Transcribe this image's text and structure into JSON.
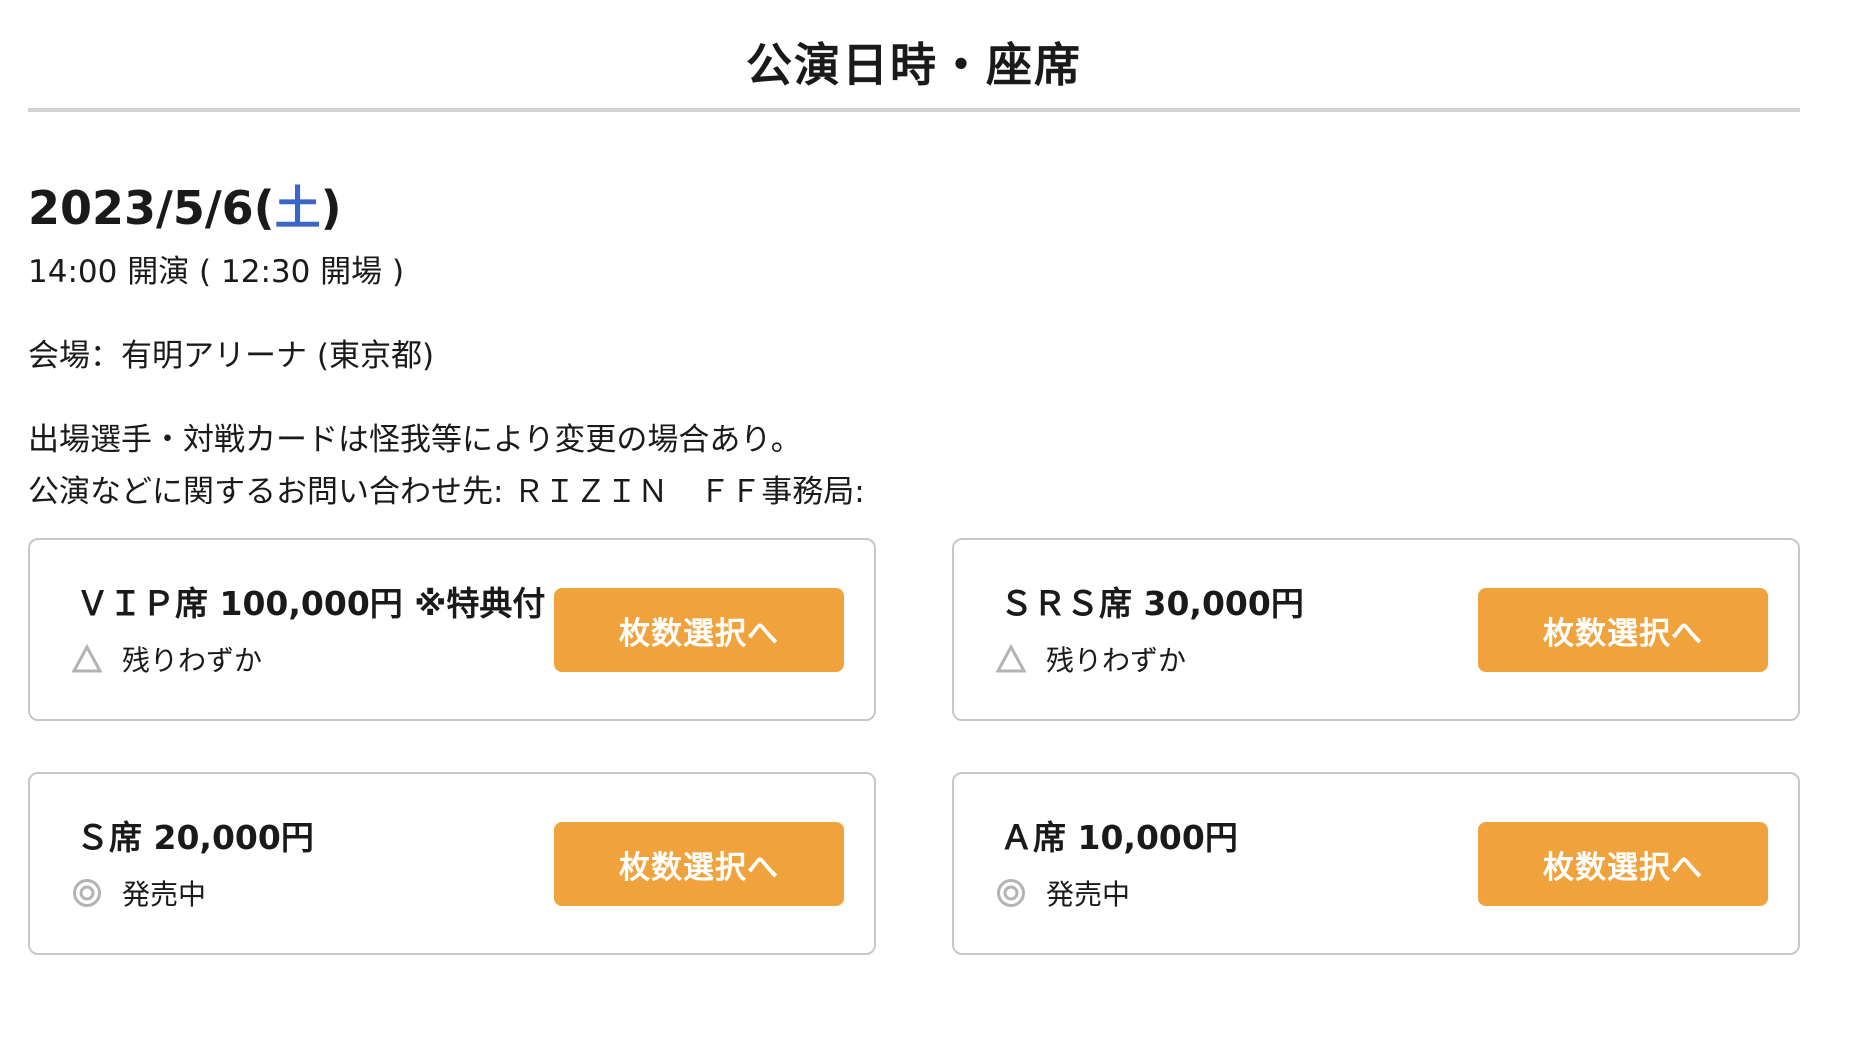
{
  "section": {
    "title": "公演日時・座席"
  },
  "performance": {
    "date": "2023/5/6(",
    "weekday": "土",
    "date_close": ")",
    "time": "14:00 開演 ( 12:30 開場 )",
    "venue": "会場：有明アリーナ (東京都)",
    "note_lines": [
      "出場選手・対戦カードは怪我等により変更の場合あり。",
      "公演などに関するお問い合わせ先: ＲＩＺＩＮ　ＦＦ事務局:"
    ]
  },
  "colors": {
    "accent_button": "#f0a33c",
    "weekday_saturday": "#3a66c8",
    "border": "#c8c8c8"
  },
  "seats": [
    {
      "name": "ＶＩＰ席 100,000円 ※特典付",
      "status_icon": "triangle-icon",
      "status": "残りわずか",
      "button_label": "枚数選択へ"
    },
    {
      "name": "ＳＲＳ席 30,000円",
      "status_icon": "triangle-icon",
      "status": "残りわずか",
      "button_label": "枚数選択へ"
    },
    {
      "name": "Ｓ席 20,000円",
      "status_icon": "double-circle-icon",
      "status": "発売中",
      "button_label": "枚数選択へ"
    },
    {
      "name": "Ａ席 10,000円",
      "status_icon": "double-circle-icon",
      "status": "発売中",
      "button_label": "枚数選択へ"
    }
  ]
}
